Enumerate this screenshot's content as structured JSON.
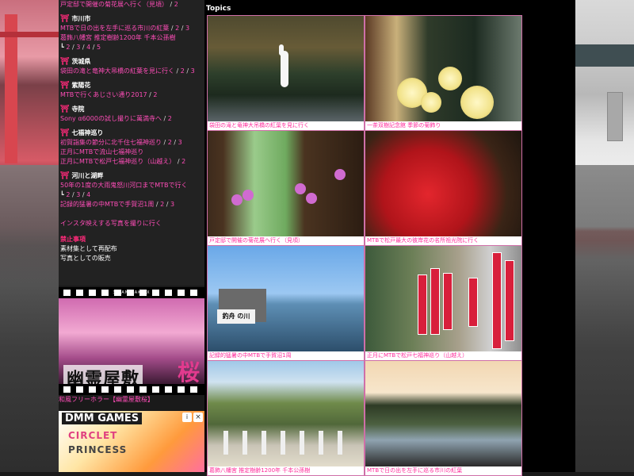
{
  "sidebar": {
    "header_link": "戸定邸で開催の菊花展へ行く（見頃）",
    "header_page": "2",
    "regions": [
      {
        "name": "市川市",
        "lines": [
          [
            {
              "t": "MTBで日の出を左手に巡る市川の紅葉",
              "link": true
            },
            {
              "t": " / ",
              "link": false
            },
            {
              "t": "2",
              "link": true
            },
            {
              "t": " / ",
              "link": false
            },
            {
              "t": "3",
              "link": true
            }
          ],
          [
            {
              "t": "葛飾八幡宮 推定樹齢1200年 千本公孫樹",
              "link": true
            }
          ],
          [
            {
              "t": "┗ ",
              "link": false
            },
            {
              "t": "2",
              "link": true
            },
            {
              "t": " / ",
              "link": false
            },
            {
              "t": "3",
              "link": true
            },
            {
              "t": " / ",
              "link": false
            },
            {
              "t": "4",
              "link": true
            },
            {
              "t": " / ",
              "link": false
            },
            {
              "t": "5",
              "link": true
            }
          ]
        ]
      },
      {
        "name": "茨城県",
        "lines": [
          [
            {
              "t": "袋田の滝と竜神大吊橋の紅葉を見に行く",
              "link": true
            },
            {
              "t": " / ",
              "link": false
            },
            {
              "t": "2",
              "link": true
            },
            {
              "t": " / ",
              "link": false
            },
            {
              "t": "3",
              "link": true
            }
          ]
        ]
      },
      {
        "name": "紫陽花",
        "lines": [
          [
            {
              "t": "MTBで行くあじさい通り2017",
              "link": true
            },
            {
              "t": " / ",
              "link": false
            },
            {
              "t": "2",
              "link": true
            }
          ]
        ]
      },
      {
        "name": "寺院",
        "lines": [
          [
            {
              "t": "Sony α6000の試し撮りに萬満寺へ",
              "link": true
            },
            {
              "t": " / ",
              "link": false
            },
            {
              "t": "2",
              "link": true
            }
          ]
        ]
      },
      {
        "name": "七福神巡り",
        "lines": [
          [
            {
              "t": "初賀詣集の節分に北千住七福神巡り",
              "link": true
            },
            {
              "t": " / ",
              "link": false
            },
            {
              "t": "2",
              "link": true
            },
            {
              "t": " / ",
              "link": false
            },
            {
              "t": "3",
              "link": true
            }
          ],
          [
            {
              "t": "正月にMTBで流山七福神巡り",
              "link": true
            }
          ],
          [
            {
              "t": "正月にMTBで松戸七福神巡り（山越え）",
              "link": true
            },
            {
              "t": " / ",
              "link": false
            },
            {
              "t": "2",
              "link": true
            }
          ]
        ]
      },
      {
        "name": "河川と湖畔",
        "lines": [
          [
            {
              "t": "50年の1度の大雨鬼怒川河口までMTBで行く",
              "link": true
            }
          ],
          [
            {
              "t": "┗ ",
              "link": false
            },
            {
              "t": "2",
              "link": true
            },
            {
              "t": " / ",
              "link": false
            },
            {
              "t": "3",
              "link": true
            },
            {
              "t": " / ",
              "link": false
            },
            {
              "t": "4",
              "link": true
            }
          ],
          [
            {
              "t": "記録的猛暑の中MTBで手賀沼1周",
              "link": true
            },
            {
              "t": " / ",
              "link": false
            },
            {
              "t": "2",
              "link": true
            },
            {
              "t": " / ",
              "link": false
            },
            {
              "t": "3",
              "link": true
            }
          ],
          [],
          [
            {
              "t": "インスタ映えする写真を撮りに行く",
              "link": true
            }
          ]
        ]
      }
    ],
    "ban_title": "禁止事項",
    "ban_items": [
      "素材集として再配布",
      "写真としての販売"
    ]
  },
  "film_ad": {
    "top_label": "3 KANIDAK EX",
    "title_text": "幽霊屋敷",
    "sakura_text": "桜",
    "caption": "和風フリーホラー【幽霊屋敷桜】"
  },
  "dmm_ad": {
    "brand": "DMM GAMES",
    "line1": "CIRCLET",
    "line2": "PRINCESS",
    "close_icon": "×",
    "ad_icon": "i"
  },
  "main": {
    "heading": "Topics",
    "tiles": [
      {
        "caption": "袋田の滝と竜神大吊橋の紅葉を見に行く",
        "kind": "heron"
      },
      {
        "caption": "一茶双樹記念館 季節の菊飾り",
        "kind": "chrys"
      },
      {
        "caption": "戸定邸で開催の菊花展へ行く（見頃）",
        "kind": "window"
      },
      {
        "caption": "MTBで松戸最大の彼岸花の名所祖光院に行く",
        "kind": "red"
      },
      {
        "caption": "記録的猛暑の中MTBで手賀沼1周",
        "kind": "lake",
        "sign": "釣舟 の川"
      },
      {
        "caption": "正月にMTBで松戸七福神巡り（山越え）",
        "kind": "flags"
      },
      {
        "caption": "葛飾八幡宮 推定樹齢1200年 千本公孫樹",
        "kind": "tree"
      },
      {
        "caption": "MTBで日の出を左手に巡る市川の紅葉",
        "kind": "pond"
      }
    ]
  },
  "colors": {
    "link": "#ff4db8",
    "pin": "#ff2a7a",
    "tile_border": "#cf6fa8",
    "caption_text": "#ff2a9a"
  }
}
